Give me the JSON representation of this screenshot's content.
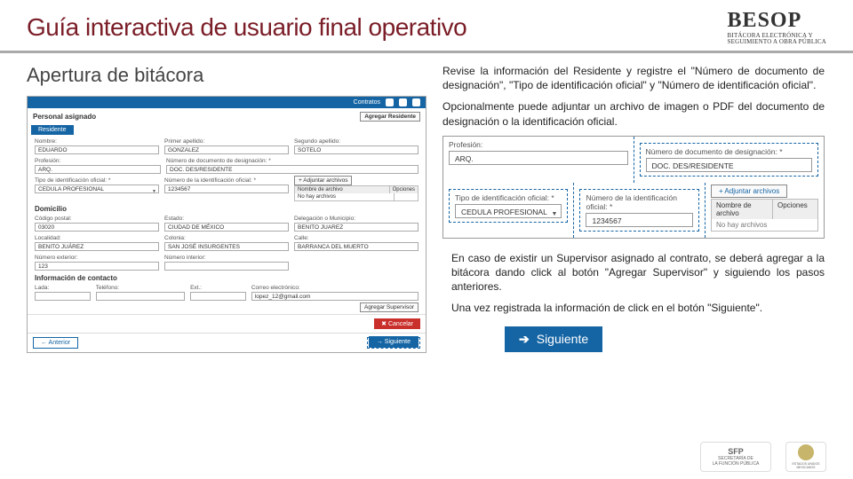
{
  "header": {
    "title": "Guía interactiva de usuario final operativo",
    "brand": "BESOP",
    "brand_sub1": "BITÁCORA ELECTRÓNICA Y",
    "brand_sub2": "SEGUIMIENTO A OBRA PÚBLICA"
  },
  "subtitle": "Apertura de bitácora",
  "instructions": {
    "p1": "Revise la información del Residente y registre el \"Número de documento de designación\", \"Tipo de identificación oficial\" y \"Número de identificación oficial\".",
    "p2": "Opcionalmente puede adjuntar un archivo de imagen o PDF del documento de designación o la identificación oficial.",
    "p3": "En caso de existir un Supervisor asignado al contrato, se deberá agregar a la bitácora dando click al botón \"Agregar Supervisor\" y siguiendo los pasos anteriores.",
    "p4": "Una vez registrada la información de click en el botón \"Siguiente\"."
  },
  "app": {
    "toolbar_label": "Contratos",
    "panel_title": "Personal asignado",
    "agregar_residente": "Agregar Residente",
    "tab": "Residente",
    "fields": {
      "nombre_lbl": "Nombre:",
      "nombre_val": "EDUARDO",
      "pap_lbl": "Primer apellido:",
      "pap_val": "GONZALEZ",
      "sap_lbl": "Segundo apellido:",
      "sap_val": "SOTELO",
      "prof_lbl": "Profesión:",
      "prof_val": "ARQ.",
      "docdes_lbl": "Número de documento de designación: *",
      "docdes_val": "DOC. DES/RESIDENTE",
      "tipoid_lbl": "Tipo de identificación oficial: *",
      "tipoid_val": "CEDULA PROFESIONAL",
      "numid_lbl": "Número de la identificación oficial: *",
      "numid_val": "1234567",
      "adj_lbl": "+ Adjuntar archivos",
      "tbl_h1": "Nombre de archivo",
      "tbl_h2": "Opciones",
      "tbl_r": "No hay archivos"
    },
    "dom_hdr": "Domicilio",
    "dom": {
      "cp_lbl": "Código postal:",
      "cp_val": "03020",
      "est_lbl": "Estado:",
      "est_val": "CIUDAD DE MÉXICO",
      "mun_lbl": "Delegación o Municipio:",
      "mun_val": "BENITO JUAREZ",
      "loc_lbl": "Localidad:",
      "loc_val": "BENITO JUÁREZ",
      "col_lbl": "Colonia:",
      "col_val": "SAN JOSÉ INSURGENTES",
      "calle_lbl": "Calle:",
      "calle_val": "BARRANCA DEL MUERTO",
      "next_lbl": "Número exterior:",
      "next_val": "123",
      "nint_lbl": "Número interior:",
      "nint_val": ""
    },
    "contact_hdr": "Información de contacto",
    "contact": {
      "lada_lbl": "Lada:",
      "tel_lbl": "Teléfono:",
      "ext_lbl": "Ext.:",
      "mail_lbl": "Correo electrónico:",
      "mail_val": "lopez_12@gmail.com"
    },
    "agregar_supervisor": "Agregar Supervisor",
    "cancelar": "✖ Cancelar",
    "anterior": "← Anterior",
    "siguiente": "→ Siguiente"
  },
  "zoom": {
    "prof_lbl": "Profesión:",
    "prof_val": "ARQ.",
    "docdes_lbl": "Número de documento de designación: *",
    "docdes_val": "DOC. DES/RESIDENTE",
    "tipoid_lbl": "Tipo de identificación oficial: *",
    "tipoid_val": "CEDULA PROFESIONAL",
    "numid_lbl": "Número de la identificación oficial: *",
    "numid_val": "1234567",
    "adj_lbl": "+  Adjuntar archivos",
    "tbl_h1": "Nombre de archivo",
    "tbl_h2": "Opciones",
    "tbl_r": "No hay archivos"
  },
  "next_button": "Siguiente",
  "footer": {
    "sfp1": "SFP",
    "sfp2": "SECRETARÍA DE",
    "sfp3": "LA FUNCIÓN PÚBLICA",
    "eum": "ESTADOS UNIDOS MEXICANOS"
  }
}
